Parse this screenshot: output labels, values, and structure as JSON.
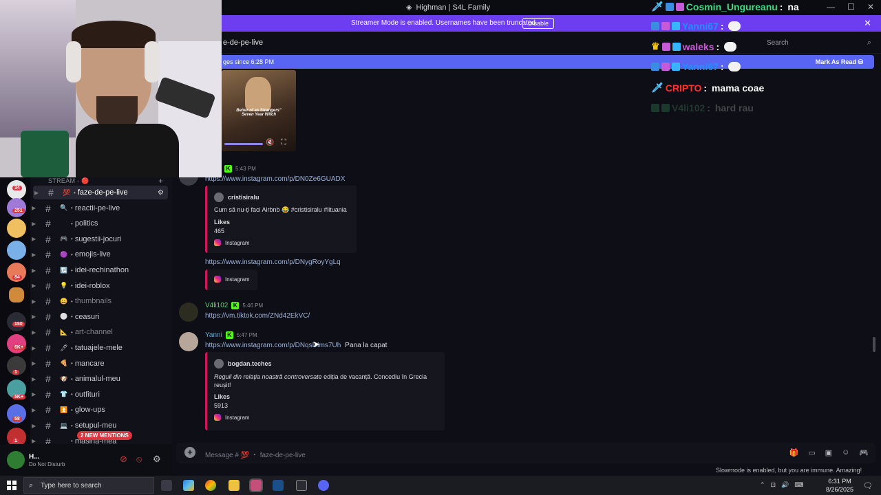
{
  "window": {
    "title": "Highman | S4L Family",
    "controls": [
      "—",
      "☐",
      "✕"
    ]
  },
  "banner": {
    "text": "Streamer Mode is enabled. Usernames have been truncated.",
    "button": "Disable",
    "close": "✕"
  },
  "header": {
    "channel": "e-de-pe-live",
    "search_placeholder": "Search"
  },
  "newbar": {
    "text": "ges since 6:28 PM",
    "action": "Mark As Read"
  },
  "video": {
    "caption_line1": "Better of as Strangers\"",
    "caption_line2": "Seven Year Witch"
  },
  "sidebar": {
    "category": "STREAM - 🔴",
    "plus": "+",
    "channels": [
      {
        "emoji": "💯",
        "name": "faze-de-pe-live",
        "active": true
      },
      {
        "emoji": "🔍",
        "name": "reactii-pe-live"
      },
      {
        "emoji": "",
        "name": "politics"
      },
      {
        "emoji": "🎮",
        "name": "sugestii-jocuri"
      },
      {
        "emoji": "🟣",
        "name": "emojis-live"
      },
      {
        "emoji": "🔃",
        "name": "idei-rechinathon"
      },
      {
        "emoji": "💡",
        "name": "idei-roblox"
      },
      {
        "emoji": "😀",
        "name": "thumbnails",
        "muted": true
      },
      {
        "emoji": "⚪",
        "name": "ceasuri"
      },
      {
        "emoji": "📐",
        "name": "art-channel",
        "muted": true
      },
      {
        "emoji": "🖊",
        "name": "tatuajele-mele"
      },
      {
        "emoji": "🍕",
        "name": "mancare"
      },
      {
        "emoji": "🐶",
        "name": "animalul-meu"
      },
      {
        "emoji": "👕",
        "name": "outfituri"
      },
      {
        "emoji": "⏫",
        "name": "glow-ups"
      },
      {
        "emoji": "💻",
        "name": "setupul-meu"
      },
      {
        "emoji": "",
        "name": "masina-mea"
      }
    ],
    "mentions": "2 NEW MENTIONS",
    "guild_badges": [
      "34",
      "251",
      "",
      "",
      "84",
      "",
      "",
      "150",
      "6K+",
      "1",
      "5K+",
      "58",
      "1"
    ]
  },
  "user": {
    "name": "H...",
    "status": "Do Not Disturb"
  },
  "messages": [
    {
      "time": "5:43 PM",
      "link": "https://www.instagram.com/p/DN0Ze6GUADX",
      "embed": {
        "author": "cristisiralu",
        "desc": "Cum să nu-ți faci Airbnb 😂 #cristisiralu #lituania",
        "likes_label": "Likes",
        "likes": "465",
        "footer": "Instagram"
      }
    },
    {
      "link": "https://www.instagram.com/p/DNygRoyYgLq",
      "embed_footer": "Instagram"
    },
    {
      "author": "V4li102",
      "time": "5:46 PM",
      "link": "https://vm.tiktok.com/ZNd42EkVC/"
    },
    {
      "author": "Yanni",
      "time": "5:47 PM",
      "link": "https://www.instagram.com/p/DNqsDIms7Uh",
      "text": "Pana la capat",
      "embed": {
        "author": "bogdan.teches",
        "desc_italic": "Reguli din relația noastră controversate",
        "desc_rest": " ediția de vacanță. Concediu în Grecia",
        "desc2": "reușit!",
        "likes_label": "Likes",
        "likes": "5913",
        "footer": "Instagram"
      }
    }
  ],
  "composer": {
    "placeholder": "Message # 💯 ・ faze-de-pe-live"
  },
  "slowmode": "Slowmode is enabled, but you are immune. Amazing!",
  "overlay": [
    {
      "user": "Cosmin_Ungureanu",
      "msg": "na",
      "color": "#3ddc84"
    },
    {
      "user": "Yanni67",
      "msg": "",
      "color": "#1e90ff"
    },
    {
      "user": "waleks",
      "msg": "",
      "color": "#c75ad6"
    },
    {
      "user": "Yanni67",
      "msg": "",
      "color": "#1e90ff"
    },
    {
      "user": "CRIPTO",
      "msg": "mama coae",
      "color": "#ff3030"
    },
    {
      "user": "V4li102",
      "msg": "hard rau",
      "color": "#3a6b4a"
    }
  ],
  "taskbar": {
    "search": "Type here to search",
    "time": "6:31 PM",
    "date": "8/26/2025"
  },
  "colors": {
    "accent": "#5865f2",
    "banner": "#6d3df0",
    "kick": "#53fc18",
    "instagram": "#d4145a"
  }
}
